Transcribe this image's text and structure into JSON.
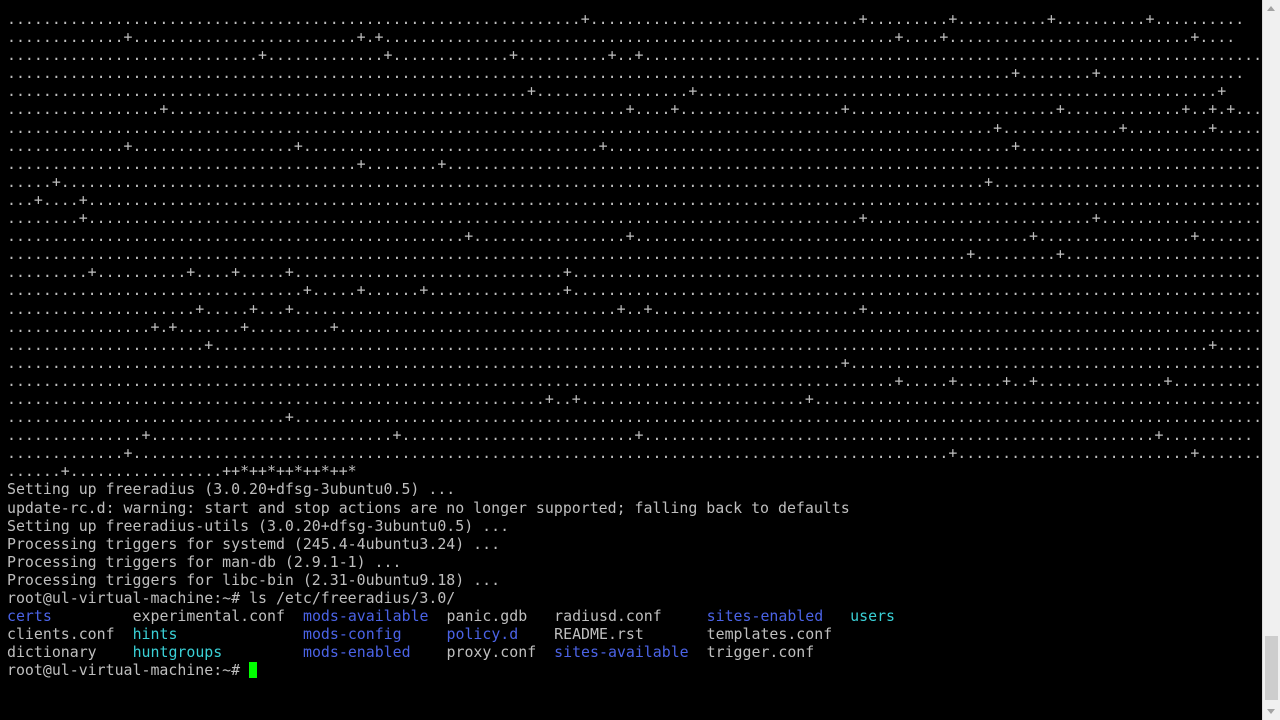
{
  "terminal": {
    "lines": [
      "................................................................+..............................+.........+..........+..........+..........",
      ".............+.........................+.+.........................................................+....+...........................+....",
      "............................+.............+.............+..........+..+.......................................................................",
      "................................................................................................................+........+................",
      "..........................................................+.................+..........................................................+",
      ".................+...................................................+....+..................+.......................+.............+..+.+....",
      "..............................................................................................................+.............+.........+.....",
      ".............+..................+.................................+.............................................+...........................",
      ".......................................+........+..............................................................................................",
      ".....+.......................................................................................................+..............................+.",
      "...+....+.....................................................................................................................................+",
      "........+......................................................................................+.........................+.....................",
      "...................................................+.................+............................................+.................+........",
      "...........................................................................................................+.........+........................",
      ".........+..........+....+.....+..............................+.......................................................................................+",
      ".................................+.....+......+...............+.............................................................................",
      ".....................+.....+...+....................................+..+.......................+...............................................",
      "................+.+.......+.........+........................................................................................................",
      "......................+...............................................................................................................+......",
      ".............................................................................................+................................................",
      "...................................................................................................+.....+.....+..+..............+..........",
      "............................................................+..+.........................+....................................................",
      "...............................+...............................................................................................................",
      "...............+...........................+..........................+.........................................................+..........",
      ".............+...........................................................................................+..........................+............",
      "......+.................++*++*++*++*++*"
    ],
    "messages": [
      "Setting up freeradius (3.0.20+dfsg-3ubuntu0.5) ...",
      "update-rc.d: warning: start and stop actions are no longer supported; falling back to defaults",
      "Setting up freeradius-utils (3.0.20+dfsg-3ubuntu0.5) ...",
      "Processing triggers for systemd (245.4-4ubuntu3.24) ...",
      "Processing triggers for man-db (2.9.1-1) ...",
      "Processing triggers for libc-bin (2.31-0ubuntu9.18) ..."
    ],
    "command_prompt": "root@ul-virtual-machine:~#",
    "command": "ls /etc/freeradius/3.0/",
    "listing": [
      [
        {
          "name": "certs",
          "type": "dir"
        },
        {
          "name": "experimental.conf",
          "type": "file"
        },
        {
          "name": "mods-available",
          "type": "dir"
        },
        {
          "name": "panic.gdb",
          "type": "file"
        },
        {
          "name": "radiusd.conf",
          "type": "file"
        },
        {
          "name": "sites-enabled",
          "type": "dir"
        },
        {
          "name": "users",
          "type": "link"
        }
      ],
      [
        {
          "name": "clients.conf",
          "type": "file"
        },
        {
          "name": "hints",
          "type": "link"
        },
        {
          "name": "mods-config",
          "type": "dir"
        },
        {
          "name": "policy.d",
          "type": "dir"
        },
        {
          "name": "README.rst",
          "type": "file"
        },
        {
          "name": "templates.conf",
          "type": "file"
        }
      ],
      [
        {
          "name": "dictionary",
          "type": "file"
        },
        {
          "name": "huntgroups",
          "type": "link"
        },
        {
          "name": "mods-enabled",
          "type": "dir"
        },
        {
          "name": "proxy.conf",
          "type": "file"
        },
        {
          "name": "sites-available",
          "type": "dir"
        },
        {
          "name": "trigger.conf",
          "type": "file"
        }
      ]
    ],
    "final_prompt": "root@ul-virtual-machine:~#",
    "colors": {
      "background": "#000000",
      "text": "#bfbfbf",
      "directory": "#4b63e6",
      "symlink": "#3ad0d6",
      "cursor": "#00ff00"
    }
  }
}
